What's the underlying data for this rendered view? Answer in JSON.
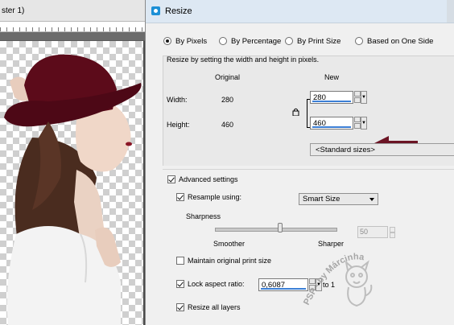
{
  "editor": {
    "title_fragment": "ster 1)"
  },
  "dialog": {
    "title": "Resize",
    "resize_by": {
      "options": [
        {
          "label": "By Pixels",
          "selected": true
        },
        {
          "label": "By Percentage",
          "selected": false
        },
        {
          "label": "By Print Size",
          "selected": false
        },
        {
          "label": "Based on One Side",
          "selected": false
        }
      ]
    },
    "pixel_group": {
      "description": "Resize by setting the width and height in pixels.",
      "col_original": "Original",
      "col_new": "New",
      "width_label": "Width:",
      "height_label": "Height:",
      "orig_width": "280",
      "orig_height": "460",
      "new_width": "280",
      "new_height": "460",
      "standard_sizes": "<Standard sizes>"
    },
    "advanced": {
      "label": "Advanced settings",
      "checked": true,
      "resample_label": "Resample using:",
      "resample_checked": true,
      "resample_value": "Smart Size",
      "sharpness_label": "Sharpness",
      "smoother_label": "Smoother",
      "sharper_label": "Sharper",
      "sharpness_value": "50",
      "sharpness_level": 0.5,
      "maintain_print_label": "Maintain original print size",
      "maintain_print_checked": false,
      "lock_aspect_label": "Lock aspect ratio:",
      "lock_aspect_checked": true,
      "aspect_value": "0,6087",
      "aspect_to": "to 1",
      "resize_all_label": "Resize all layers",
      "resize_all_checked": true
    },
    "watermark": "PSP - by Márcinha"
  },
  "colors": {
    "highlight_arrow": "#6b1424",
    "hat": "#6a0e1e",
    "accent_blue": "#3c7fd5"
  }
}
